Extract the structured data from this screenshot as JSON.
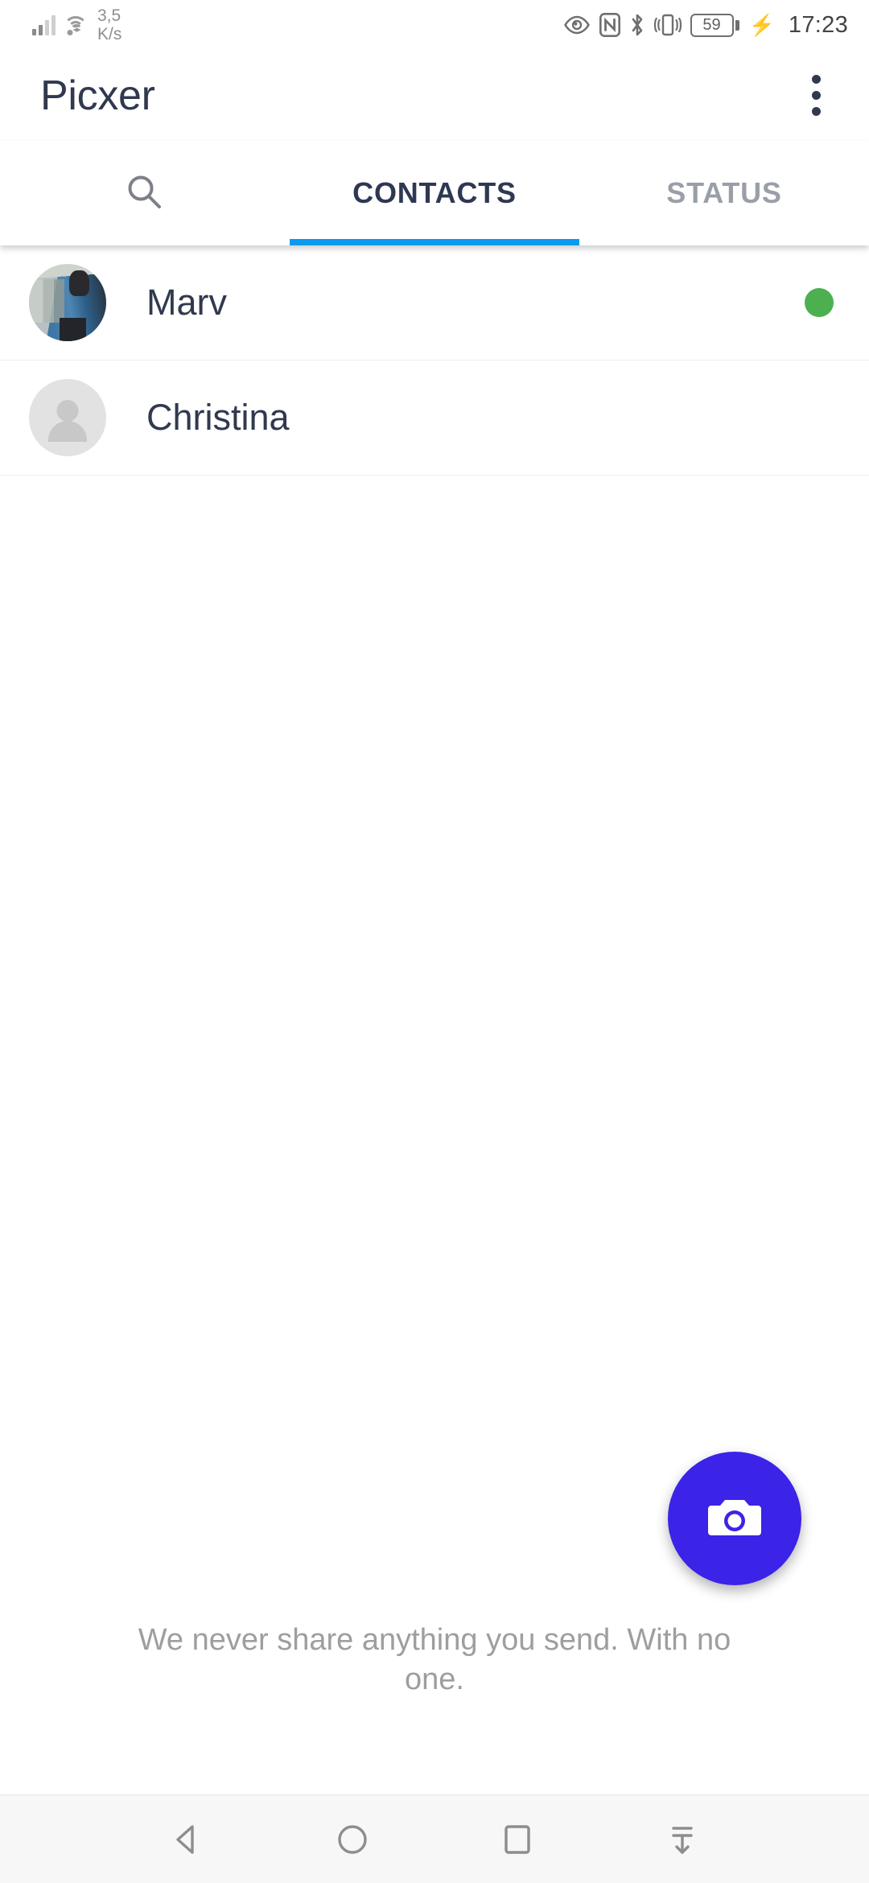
{
  "statusbar": {
    "network_speed": "3,5\nK/s",
    "network_speed_value": "3,5",
    "network_speed_unit": "K/s",
    "signal_bars_filled": 2,
    "signal_bars_total": 4,
    "icons": [
      "eye-comfort-icon",
      "nfc-icon",
      "bluetooth-icon",
      "vibrate-icon"
    ],
    "battery_level": "59",
    "charging": true,
    "time": "17:23"
  },
  "appbar": {
    "title": "Picxer",
    "overflow_label": "More options"
  },
  "tabs": [
    {
      "id": "search",
      "label": "",
      "icon": "search-icon",
      "active": false
    },
    {
      "id": "contacts",
      "label": "CONTACTS",
      "icon": "",
      "active": true
    },
    {
      "id": "status",
      "label": "STATUS",
      "icon": "",
      "active": false
    }
  ],
  "contacts": [
    {
      "name": "Marv",
      "avatar_type": "photo",
      "online": true
    },
    {
      "name": "Christina",
      "avatar_type": "placeholder",
      "online": false
    }
  ],
  "fab": {
    "icon": "camera-icon",
    "label": "Take photo",
    "color": "#3b23e8"
  },
  "footer": {
    "note": "We never share anything you send. With no one."
  },
  "navbar": {
    "buttons": [
      {
        "id": "back",
        "icon": "back-triangle-icon"
      },
      {
        "id": "home",
        "icon": "home-circle-icon"
      },
      {
        "id": "recents",
        "icon": "recents-square-icon"
      },
      {
        "id": "notifications",
        "icon": "pull-down-notifications-icon"
      }
    ]
  },
  "colors": {
    "accent_blue": "#0a9bf0",
    "fab_indigo": "#3b23e8",
    "online_green": "#4caf50",
    "text_dark": "#31394f",
    "text_muted": "#9e9e9e"
  }
}
